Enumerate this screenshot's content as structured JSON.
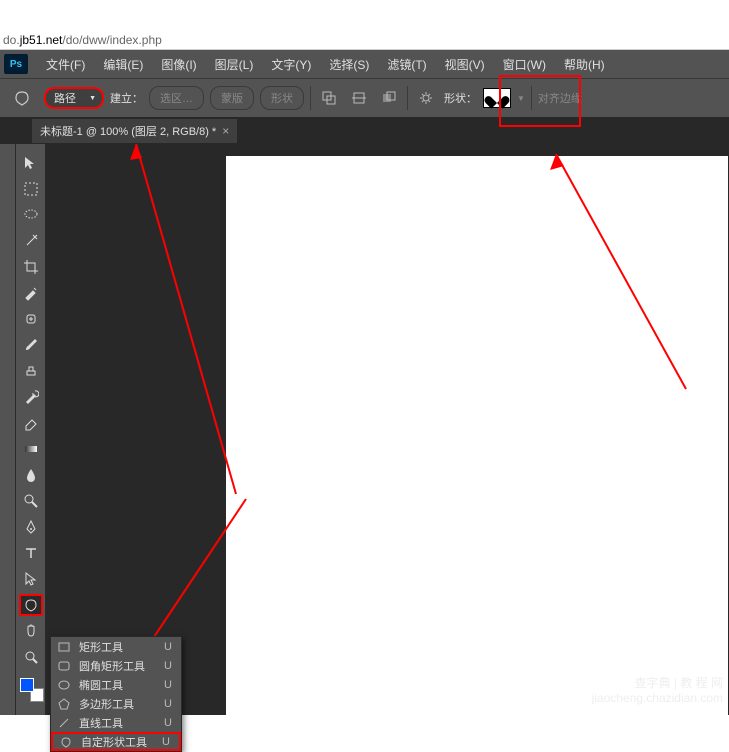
{
  "browser": {
    "url_prefix": "do.",
    "url_domain": "jb51.net",
    "url_path": "/do/dww/index.php"
  },
  "menu": {
    "file": "文件(F)",
    "edit": "编辑(E)",
    "image": "图像(I)",
    "layer": "图层(L)",
    "type": "文字(Y)",
    "select": "选择(S)",
    "filter": "滤镜(T)",
    "view": "视图(V)",
    "window": "窗口(W)",
    "help": "帮助(H)"
  },
  "options": {
    "mode": "路径",
    "build_label": "建立：",
    "selection": "选区…",
    "mask": "蒙版",
    "shape": "形状",
    "shape_label": "形状：",
    "align_edges": "对齐边缘"
  },
  "tab": {
    "title": "未标题-1 @ 100% (图层 2, RGB/8) *"
  },
  "flyout": {
    "items": [
      {
        "label": "矩形工具",
        "shortcut": "U",
        "icon": "rect"
      },
      {
        "label": "圆角矩形工具",
        "shortcut": "U",
        "icon": "roundrect"
      },
      {
        "label": "椭圆工具",
        "shortcut": "U",
        "icon": "ellipse"
      },
      {
        "label": "多边形工具",
        "shortcut": "U",
        "icon": "polygon"
      },
      {
        "label": "直线工具",
        "shortcut": "U",
        "icon": "line"
      },
      {
        "label": "自定形状工具",
        "shortcut": "U",
        "icon": "custom",
        "selected": true
      }
    ]
  },
  "watermark": {
    "line1": "查字典 | 教 程 网",
    "line2": "jiaocheng.chazidian.com"
  },
  "ps_logo": "Ps"
}
